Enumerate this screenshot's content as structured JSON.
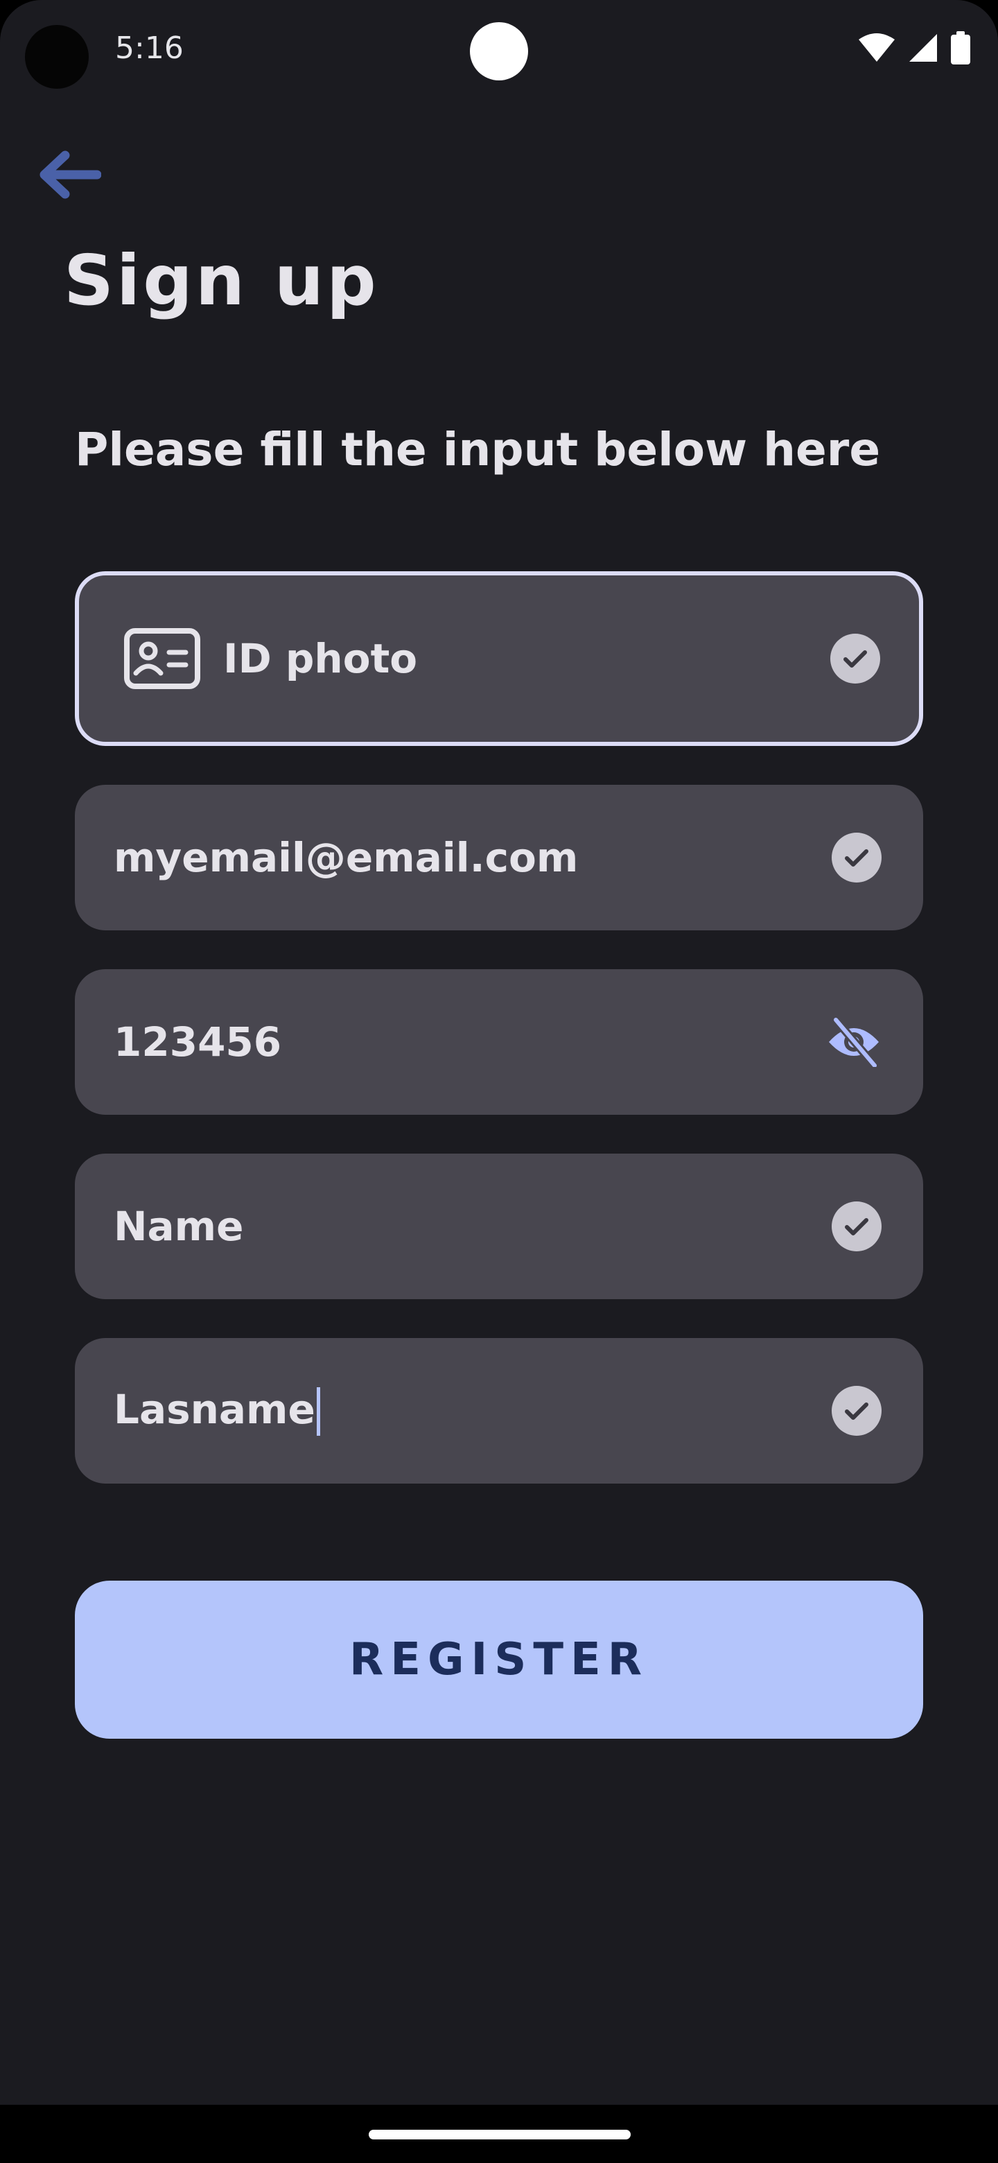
{
  "status_bar": {
    "time": "5:16",
    "icons": [
      "wifi-icon",
      "signal-icon",
      "battery-icon"
    ]
  },
  "header": {
    "back_icon": "arrow-left-icon",
    "title": "Sign up"
  },
  "form": {
    "subtitle": "Please fill the input below here",
    "fields": [
      {
        "name": "id-photo",
        "value": "ID photo",
        "leading_icon": "id-card-icon",
        "trailing_icon": "check-circle-icon",
        "focused": true
      },
      {
        "name": "email",
        "value": "myemail@email.com",
        "trailing_icon": "check-circle-icon"
      },
      {
        "name": "password",
        "value": "123456",
        "trailing_icon": "eye-off-icon"
      },
      {
        "name": "name",
        "value": "Name",
        "trailing_icon": "check-circle-icon"
      },
      {
        "name": "lastname",
        "value": "Lasname",
        "trailing_icon": "check-circle-icon",
        "has_cursor": true
      }
    ]
  },
  "register_label": "REGISTER",
  "colors": {
    "background": "#1b1b20",
    "field_background": "#48464f",
    "focus_border": "#dcdcf6",
    "accent": "#b4c5fb",
    "accent_text": "#1c2d5b",
    "back_icon": "#4a61a8",
    "eye_icon": "#aebcff"
  }
}
